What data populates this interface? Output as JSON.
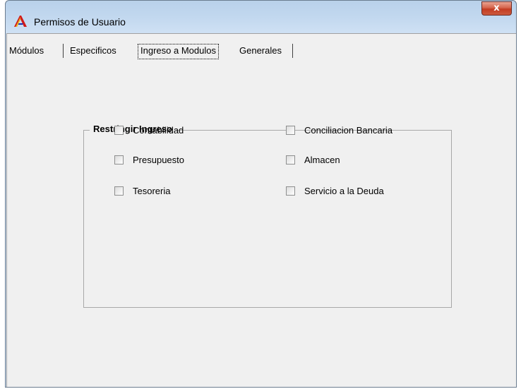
{
  "window": {
    "title": "Permisos de Usuario",
    "close_glyph": "x",
    "icon": "app-logo-icon"
  },
  "tabs": [
    {
      "label": "Módulos",
      "active": false
    },
    {
      "label": "Especificos",
      "active": false
    },
    {
      "label": "Ingreso a Modulos",
      "active": true
    },
    {
      "label": "Generales",
      "active": false
    }
  ],
  "group": {
    "title": "Restringir Ingreso",
    "checkboxes": [
      {
        "label": "Contabilidad",
        "checked": false
      },
      {
        "label": "Presupuesto",
        "checked": false
      },
      {
        "label": "Tesoreria",
        "checked": false
      },
      {
        "label": "Conciliacion Bancaria",
        "checked": false
      },
      {
        "label": "Almacen",
        "checked": false
      },
      {
        "label": "Servicio a la Deuda",
        "checked": false
      }
    ]
  },
  "colors": {
    "titlebar": "#c2d8ef",
    "close_button": "#c33c22",
    "client_bg": "#f0f0f0"
  }
}
